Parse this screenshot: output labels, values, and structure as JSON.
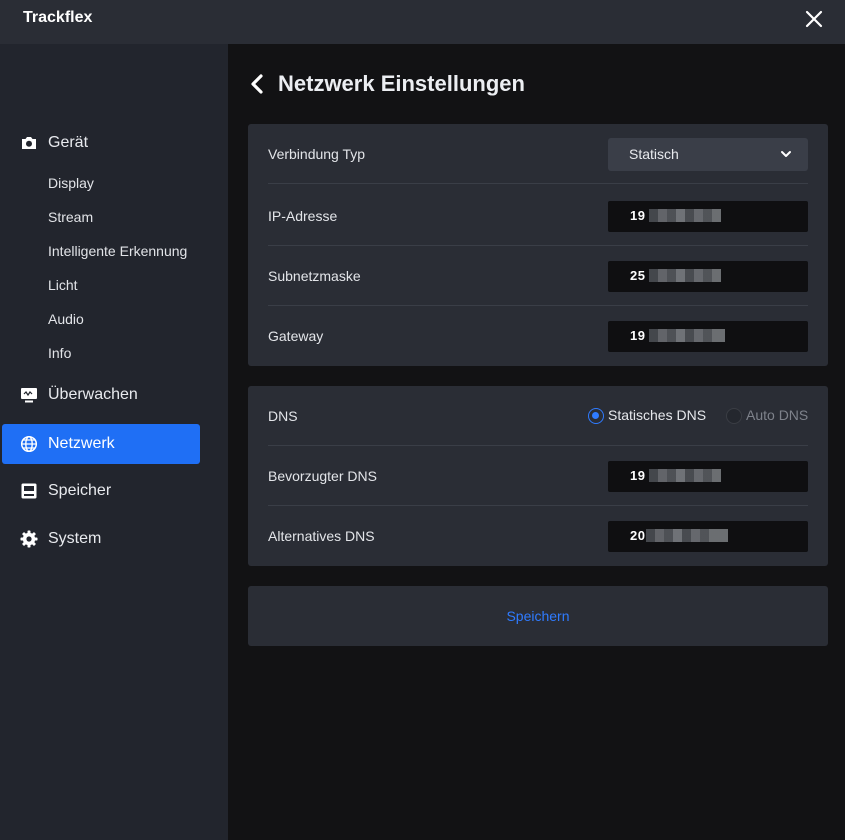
{
  "app": {
    "title": "Trackflex"
  },
  "sidebar": {
    "items": [
      {
        "label": "Gerät",
        "icon": "camera-icon"
      },
      {
        "label": "Display"
      },
      {
        "label": "Stream"
      },
      {
        "label": "Intelligente Erkennung"
      },
      {
        "label": "Licht"
      },
      {
        "label": "Audio"
      },
      {
        "label": "Info"
      },
      {
        "label": "Überwachen",
        "icon": "monitor-icon"
      },
      {
        "label": "Netzwerk",
        "icon": "globe-icon",
        "active": true
      },
      {
        "label": "Speicher",
        "icon": "storage-icon"
      },
      {
        "label": "System",
        "icon": "gear-icon"
      }
    ]
  },
  "page": {
    "title": "Netzwerk Einstellungen"
  },
  "network": {
    "connection_type": {
      "label": "Verbindung Typ",
      "value": "Statisch"
    },
    "ip": {
      "label": "IP-Adresse",
      "visible_prefix": "19"
    },
    "subnet": {
      "label": "Subnetzmaske",
      "visible_prefix": "25"
    },
    "gateway": {
      "label": "Gateway",
      "visible_prefix": "19"
    }
  },
  "dns": {
    "label": "DNS",
    "options": [
      {
        "label": "Statisches DNS",
        "selected": true
      },
      {
        "label": "Auto DNS",
        "selected": false
      }
    ],
    "preferred": {
      "label": "Bevorzugter DNS",
      "visible_prefix": "19"
    },
    "alternative": {
      "label": "Alternatives DNS",
      "visible_prefix": "20"
    }
  },
  "actions": {
    "save_label": "Speichern"
  },
  "colors": {
    "accent": "#1f6ff5",
    "link": "#2f7bff"
  }
}
